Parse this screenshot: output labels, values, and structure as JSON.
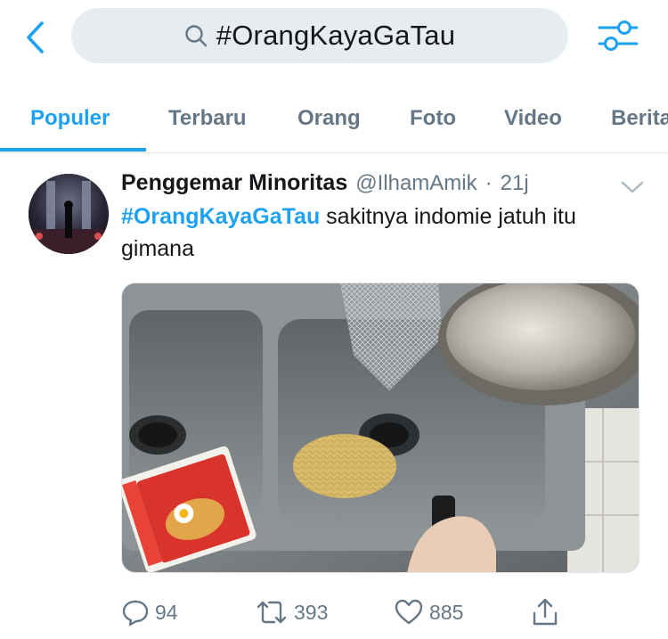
{
  "search": {
    "query": "#OrangKayaGaTau"
  },
  "tabs": [
    {
      "label": "Populer",
      "active": true
    },
    {
      "label": "Terbaru",
      "active": false
    },
    {
      "label": "Orang",
      "active": false
    },
    {
      "label": "Foto",
      "active": false
    },
    {
      "label": "Video",
      "active": false
    },
    {
      "label": "Berita",
      "active": false
    }
  ],
  "tweet": {
    "display_name": "Penggemar Minoritas",
    "handle": "@IlhamAmik",
    "separator": "·",
    "time": "21j",
    "hashtag": "#OrangKayaGaTau",
    "text": " sakitnya indomie jatuh itu gimana",
    "media_label": "Photo of instant noodles spilled in a kitchen sink",
    "actions": {
      "replies": "94",
      "retweets": "393",
      "likes": "885"
    }
  },
  "colors": {
    "accent": "#1da1f2",
    "secondary_text": "#657786",
    "search_bg": "#e6ecf0"
  },
  "icons": [
    "chevron-left-icon",
    "search-icon",
    "sliders-icon",
    "chevron-down-icon",
    "reply-icon",
    "retweet-icon",
    "heart-icon",
    "share-icon"
  ]
}
